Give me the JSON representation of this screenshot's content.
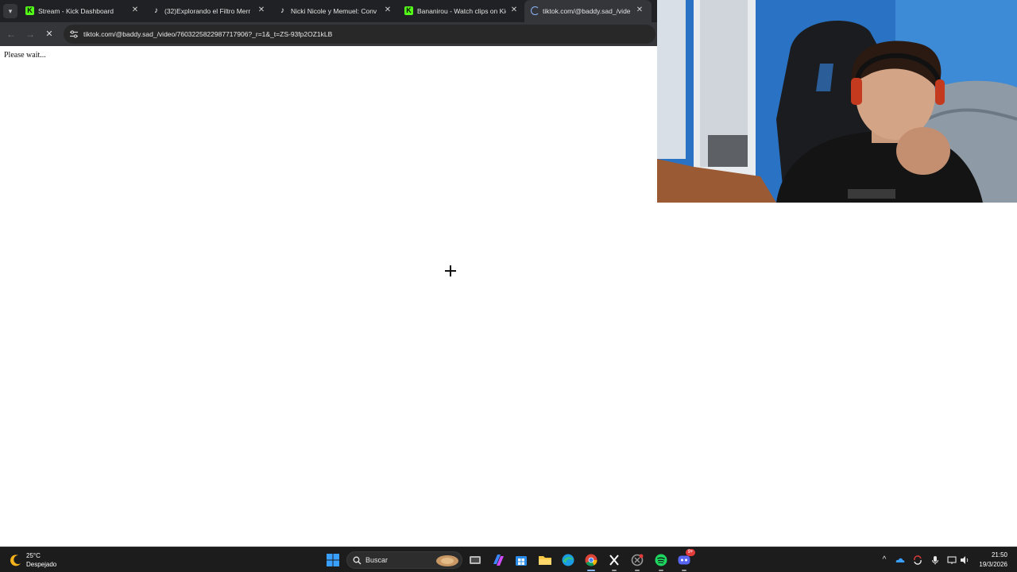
{
  "browser": {
    "tabs": [
      {
        "title": "Stream - Kick Dashboard",
        "favicon": "kick-icon",
        "active": false
      },
      {
        "title": "(32)Explorando el Filtro Mernue",
        "favicon": "tiktok-icon",
        "active": false
      },
      {
        "title": "Nicki Nicole y Memuel: Convers",
        "favicon": "tiktok-icon",
        "active": false
      },
      {
        "title": "Bananirou - Watch clips on Kick",
        "favicon": "kick-icon",
        "active": false
      },
      {
        "title": "tiktok.com/@baddy.sad_/video",
        "favicon": "loading-spinner-icon",
        "active": true
      }
    ],
    "address": "tiktok.com/@baddy.sad_/video/7603225822987717906?_r=1&_t=ZS-93fp2OZ1kLB",
    "accent_color": "#53fc18"
  },
  "page": {
    "status_text": "Please wait..."
  },
  "taskbar": {
    "weather_temp": "25°C",
    "weather_desc": "Despejado",
    "search_placeholder": "Buscar",
    "time": "21:50",
    "date": "19/3/2026",
    "discord_badge": "9+",
    "pinned_apps": [
      "windows-start-icon",
      "search-icon",
      "widget-icon",
      "task-view-icon",
      "copilot-icon",
      "store-icon",
      "file-explorer-icon",
      "edge-icon",
      "chrome-icon",
      "x-icon",
      "app-icon",
      "spotify-icon",
      "discord-icon"
    ]
  }
}
